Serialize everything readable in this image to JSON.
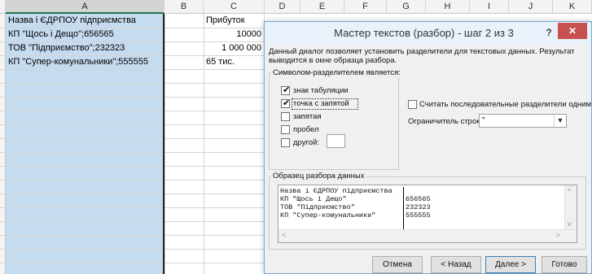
{
  "spreadsheet": {
    "columns": [
      "A",
      "B",
      "C",
      "D",
      "E",
      "F",
      "G",
      "H",
      "I",
      "J",
      "K"
    ],
    "cells": {
      "a1": "Назва і ЄДРПОУ підприємства",
      "a2": "КП \"Щось і Дещо\";656565",
      "a3": "ТОВ \"Підприємство\";232323",
      "a4": "КП \"Супер-комунальники\";555555",
      "c1": "Прибуток",
      "c2": "10000",
      "c3": "1 000 000",
      "c4": "65 тис."
    }
  },
  "dialog": {
    "title": "Мастер текстов (разбор) - шаг 2 из 3",
    "help": "?",
    "close": "✕",
    "description": "Данный диалог позволяет установить разделители для текстовых данных. Результат выводится в окне образца разбора.",
    "delimiters_group": "Символом-разделителем является:",
    "checkboxes": [
      {
        "label": "знак табуляции",
        "checked": true
      },
      {
        "label": "точка с запятой",
        "checked": true
      },
      {
        "label": "запятая",
        "checked": false
      },
      {
        "label": "пробел",
        "checked": false
      },
      {
        "label": "другой:",
        "checked": false
      }
    ],
    "consecutive_label": "Считать последовательные разделители одним",
    "consecutive_checked": false,
    "qualifier_label": "Ограничитель строк:",
    "qualifier_value": "\"",
    "preview_group": "Образец разбора данных",
    "preview_rows": [
      {
        "col1": "Назва і ЄДРПОУ підприємства",
        "col2": ""
      },
      {
        "col1": "КП \"Щось і Дещо\"",
        "col2": "656565"
      },
      {
        "col1": "ТОВ \"Підприємство\"",
        "col2": "232323"
      },
      {
        "col1": "КП \"Супер-комунальники\"",
        "col2": "555555"
      }
    ],
    "buttons": {
      "cancel": "Отмена",
      "back": "< Назад",
      "next": "Далее >",
      "finish": "Готово"
    }
  }
}
